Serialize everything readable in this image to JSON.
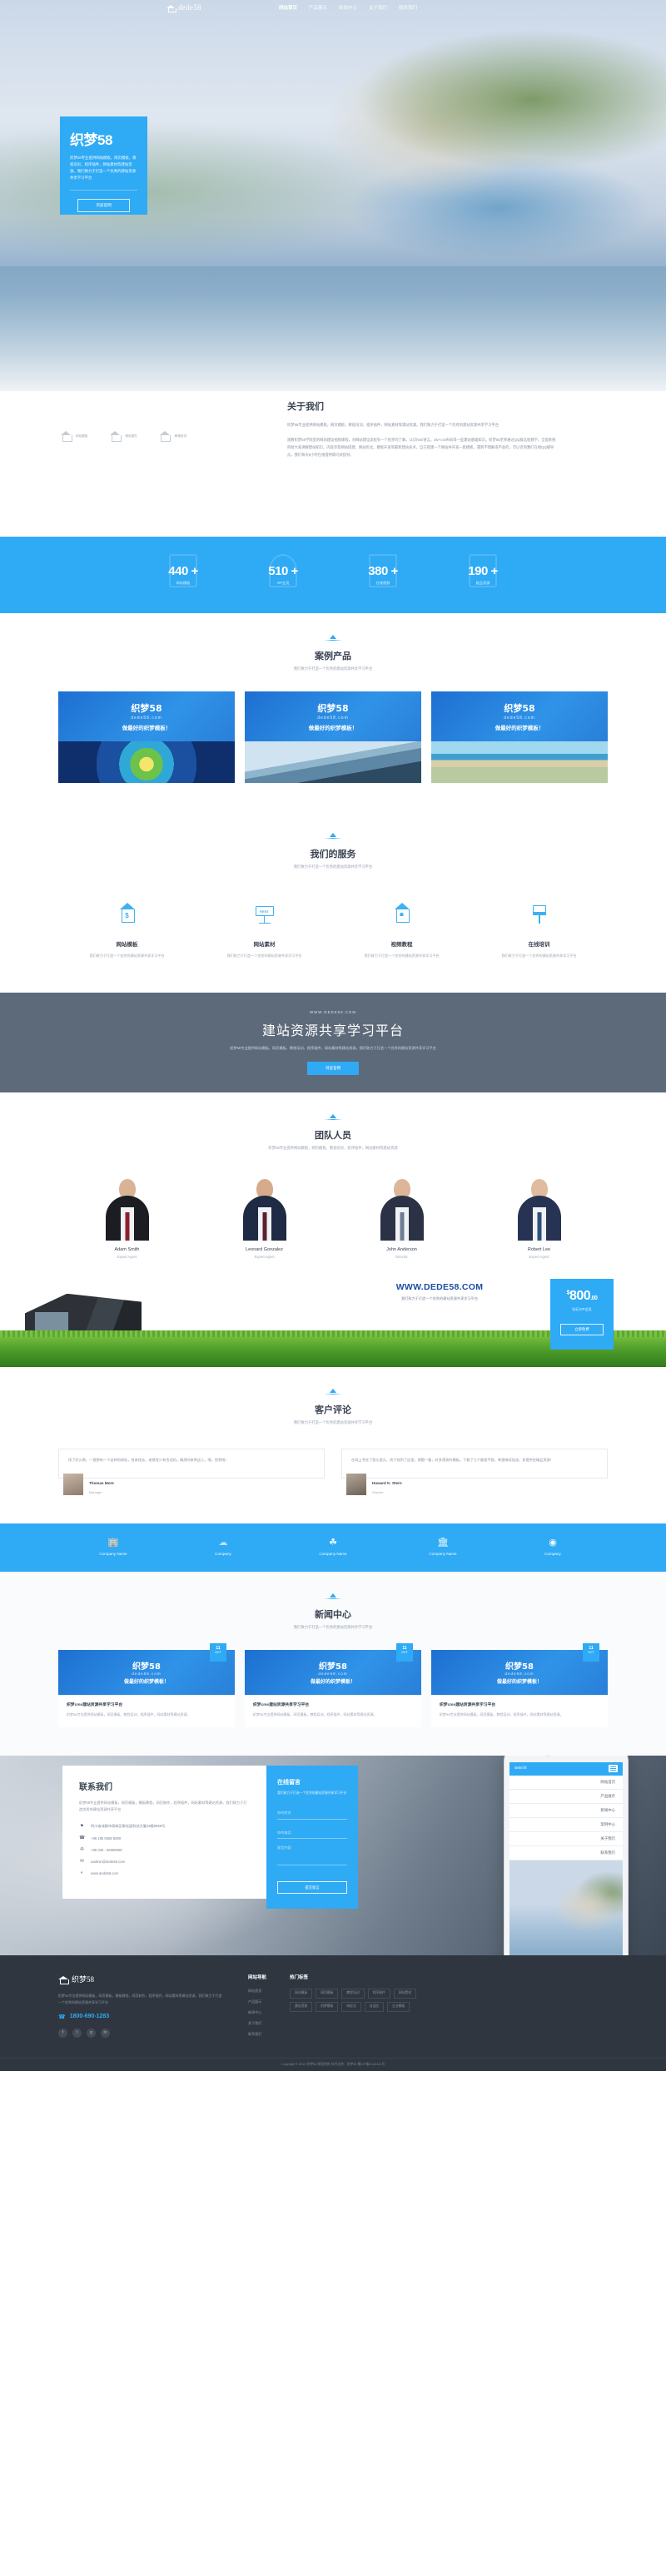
{
  "site": {
    "logo_text": "dede58",
    "brand_cn": "织梦58"
  },
  "nav": {
    "items": [
      {
        "label": "网站首页",
        "active": true
      },
      {
        "label": "产品展示"
      },
      {
        "label": "新闻中心"
      },
      {
        "label": "关于我们"
      },
      {
        "label": "联系我们"
      }
    ]
  },
  "hero": {
    "title": "织梦58",
    "desc": "织梦58专业提供网站模板，网页模板，教程培训，程序插件，网站素材等建站资源。我们致力于打造一个优秀的建站资源共享学习平台",
    "button": "浏览官网"
  },
  "about": {
    "title": "关于我们",
    "p1": "织梦58专业提供网站模板，网页模板，教程培训，程序插件，网站素材等建站资源。我们致力于打造一个优秀的建站资源共享学习平台",
    "p2": "观看织梦58学院里的网站建设视频课程，对网站建设流程有一个初步的了解。认识html语言，div+css布局等一些建站基础知识。织梦58老师通过QQ群远程教学，全面系统的给大家讲解建站知识。内容涉及网站搭建，网站优化，模板开发等最新建站技术。自己搭建一个网站并开发一套模板，遇到不理解或不会的，可以咨询我们在线QQ辅导员，我们每天8小时在线提供即问式指导。",
    "features": [
      {
        "label": "网站模板",
        "icon": "house-icon"
      },
      {
        "label": "程序插件",
        "icon": "house-icon"
      },
      {
        "label": "教程培训",
        "icon": "house-icon"
      }
    ]
  },
  "stats": {
    "items": [
      {
        "value": "440",
        "suffix": "+",
        "label": "网站模板"
      },
      {
        "value": "510",
        "suffix": "+",
        "label": "VIP会员"
      },
      {
        "value": "380",
        "suffix": "+",
        "label": "在线视频"
      },
      {
        "value": "190",
        "suffix": "+",
        "label": "极品资源"
      }
    ]
  },
  "products": {
    "title": "案例产品",
    "subtitle": "我们致力于打造一个优秀的建站资源共享学习平台",
    "cards": [
      {
        "t1": "织梦58",
        "t2": "dede58.com",
        "t3": "做最好的织梦模板！"
      },
      {
        "t1": "织梦58",
        "t2": "dede58.com",
        "t3": "做最好的织梦模板！"
      },
      {
        "t1": "织梦58",
        "t2": "dede58.com",
        "t3": "做最好的织梦模板！"
      }
    ]
  },
  "services": {
    "title": "我们的服务",
    "subtitle": "我们致力于打造一个优秀的建站资源共享学习平台",
    "items": [
      {
        "name": "网站模板",
        "desc": "我们致力于打造一个优秀的建站资源共享学习平台",
        "icon": "house-dollar-icon"
      },
      {
        "name": "网站素材",
        "desc": "我们致力于打造一个优秀的建站资源共享学习平台",
        "icon": "rent-sign-icon",
        "sign_text": "RENT"
      },
      {
        "name": "视频教程",
        "desc": "我们致力于打造一个优秀的建站资源共享学习平台",
        "icon": "house-hand-icon"
      },
      {
        "name": "在线培训",
        "desc": "我们致力于打造一个优秀的建站资源共享学习平台",
        "icon": "paint-brush-icon"
      }
    ]
  },
  "cta": {
    "url": "WWW.DEDE58.COM",
    "title": "建站资源共享学习平台",
    "desc": "织梦58专业提供网站模板，网页模板，教程培训，程序插件，网站素材等建站资源。我们致力于打造一个优秀的建站资源共享学习平台",
    "button": "浏览官网"
  },
  "team": {
    "title": "团队人员",
    "subtitle": "织梦58专业提供网站模板，网页模板，教程培训，程序插件，网站素材等建站资源",
    "members": [
      {
        "name": "Adam Smith",
        "role": "Expert Agent",
        "suit": "#1b1d22",
        "tie": "#8c1f2a",
        "skin": "#d9b396"
      },
      {
        "name": "Leonard Gonzalez",
        "role": "Expert Agent",
        "suit": "#1f2a44",
        "tie": "#5b2030",
        "skin": "#d6ab8c"
      },
      {
        "name": "John Anderson",
        "role": "Director",
        "suit": "#2b3246",
        "tie": "#6e7d92",
        "skin": "#ddb69a"
      },
      {
        "name": "Robert Lee",
        "role": "Expert Agent",
        "suit": "#263353",
        "tie": "#2e4f7a",
        "skin": "#e0bb9e"
      }
    ]
  },
  "promo": {
    "title": "WWW.DEDE58.COM",
    "subtitle": "我们致力于打造一个优秀的建站资源共享学习平台",
    "price_currency": "$",
    "price_amount": "800",
    "price_cents": ".00",
    "plan": "钻石VIP会员",
    "button": "立即免费"
  },
  "testimonials": {
    "title": "客户评论",
    "subtitle": "我们致力于打造一个优秀的建站资源共享学习平台",
    "items": [
      {
        "text": "找了好久啊，一直想有一个这样的网站，找来找去，老感觉少有合适的。偶然间来到这儿，嘿，找到啦！",
        "name": "Thomas More",
        "role": "Manager"
      },
      {
        "text": "在网上寻觅了很久很久，终于找到了这里。周围一看，好多漂亮的模板。下载了几个都很不错，希望继续加油，多提供些精品资源！",
        "name": "Howard K. Stern",
        "role": "Director"
      }
    ]
  },
  "partners": {
    "items": [
      {
        "name": "Company Name",
        "icon": "building-icon"
      },
      {
        "name": "Company",
        "icon": "cloud-icon"
      },
      {
        "name": "Company Name",
        "icon": "leaf-icon"
      },
      {
        "name": "Company Name",
        "icon": "bank-icon"
      },
      {
        "name": "Company",
        "icon": "circle-icon"
      }
    ]
  },
  "news": {
    "title": "新闻中心",
    "subtitle": "我们致力于打造一个优秀的建站资源共享学习平台",
    "items": [
      {
        "t1": "织梦58",
        "t2": "dede58.com",
        "t3": "做最好的织梦模板！",
        "day": "11",
        "month": "OCT",
        "headline": "织梦cms建站资源共享学习平台",
        "excerpt": "织梦58专业提供网站模板，网页模板，教程培训，程序插件，网站素材等建站资源。"
      },
      {
        "t1": "织梦58",
        "t2": "dede58.com",
        "t3": "做最好的织梦模板！",
        "day": "11",
        "month": "OCT",
        "headline": "织梦cms建站资源共享学习平台",
        "excerpt": "织梦58专业提供网站模板，网页模板，教程培训，程序插件，网站素材等建站资源。"
      },
      {
        "t1": "织梦58",
        "t2": "dede58.com",
        "t3": "做最好的织梦模板！",
        "day": "11",
        "month": "OCT",
        "headline": "织梦cms建站资源共享学习平台",
        "excerpt": "织梦58专业提供网站模板，网页模板，教程培训，程序插件，网站素材等建站资源。"
      }
    ]
  },
  "contact": {
    "title": "联系我们",
    "desc": "织梦58专业提供网站模板，网页模板，模板教程，网页制作，程序插件，网站素材等建站资源，我们致力于打造优秀的建站资源共享平台",
    "rows": [
      {
        "icon": "location-pin-icon",
        "glyph": "⚑",
        "text": "四川省成都市高新区孵化园科技大厦18楼5858号"
      },
      {
        "icon": "phone-icon",
        "glyph": "☎",
        "text": "+86 186 6588 8899"
      },
      {
        "icon": "fax-icon",
        "glyph": "✇",
        "text": "+86 028 - 66988858"
      },
      {
        "icon": "email-icon",
        "glyph": "✉",
        "text": "aadmin@dede58.com"
      },
      {
        "icon": "globe-icon",
        "glyph": "◐",
        "text": "www.dede58.com"
      }
    ]
  },
  "message_panel": {
    "title": "在线留言",
    "subtitle": "我们致力于打造一个优秀的建站资源共享学习平台",
    "name_placeholder": "你的姓名",
    "phone_placeholder": "你的电话",
    "content_placeholder": "留言内容",
    "button": "提交留言"
  },
  "phone_mock": {
    "logo": "dede58",
    "menu": [
      "网站首页",
      "产品展示",
      "新闻中心",
      "案例中心",
      "关于我们",
      "联系我们"
    ]
  },
  "footer": {
    "brand": "织梦58",
    "about": "织梦58专业提供网站模板，网页模板，模板教程，网页制作，程序插件，网站素材等建站资源，我们致力于打造一个优秀的建站资源共享学习平台",
    "phone_label": "1800-690-1283",
    "socials": [
      "f",
      "t",
      "g",
      "in"
    ],
    "col2": {
      "title": "网站导航",
      "links": [
        "网站首页",
        "产品展示",
        "新闻中心",
        "关于我们",
        "联系我们"
      ]
    },
    "col3": {
      "title": "热门标签",
      "tags": [
        "网站模板",
        "网页模板",
        "教程培训",
        "程序插件",
        "网站素材",
        "建站资源",
        "织梦模板",
        "响应式",
        "自适应",
        "企业模板"
      ]
    },
    "copyright": "Copyright © 2019 织梦58 版权所有  技术支持：织梦58  蜀ICP备11111111号"
  },
  "colors": {
    "accent": "#2faaf5",
    "dark": "#2f3640",
    "slate": "#5d6a7a",
    "deep_blue": "#1e6fd0"
  }
}
